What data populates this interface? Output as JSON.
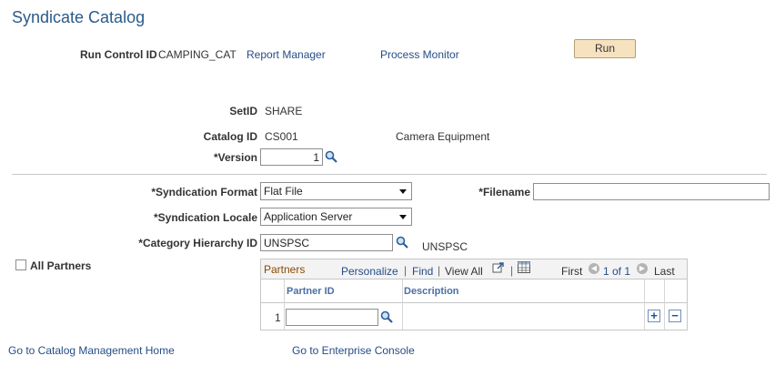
{
  "page": {
    "title": "Syndicate Catalog"
  },
  "run_control": {
    "label": "Run Control ID",
    "value": "CAMPING_CAT",
    "report_manager": "Report Manager",
    "process_monitor": "Process Monitor",
    "run_button": "Run"
  },
  "fields": {
    "setid_label": "SetID",
    "setid_value": "SHARE",
    "catalog_label": "Catalog ID",
    "catalog_value": "CS001",
    "catalog_desc": "Camera Equipment",
    "version_label": "*Version",
    "version_value": "1",
    "format_label": "*Syndication Format",
    "format_value": "Flat File",
    "filename_label": "*Filename",
    "filename_value": "",
    "locale_label": "*Syndication Locale",
    "locale_value": "Application Server",
    "hierarchy_label": "*Category Hierarchy ID",
    "hierarchy_value": "UNSPSC",
    "hierarchy_desc": "UNSPSC",
    "all_partners_label": "All Partners"
  },
  "partners_grid": {
    "title": "Partners",
    "personalize": "Personalize",
    "find": "Find",
    "sep1": "|",
    "sep2": "|",
    "view_all": "View All",
    "sep3": "|",
    "sep4": "|",
    "first": "First",
    "range": "1 of 1",
    "last": "Last",
    "col_partner_id": "Partner ID",
    "col_description": "Description",
    "row_num": "1",
    "row_partner_id": ""
  },
  "footer": {
    "catalog_home": "Go to Catalog Management Home",
    "enterprise_console": "Go to Enterprise Console"
  },
  "colors": {
    "title": "#2a5b8c",
    "link": "#264d87",
    "run_button": "#f6e2bf",
    "grid_title": "#8a4a00"
  }
}
